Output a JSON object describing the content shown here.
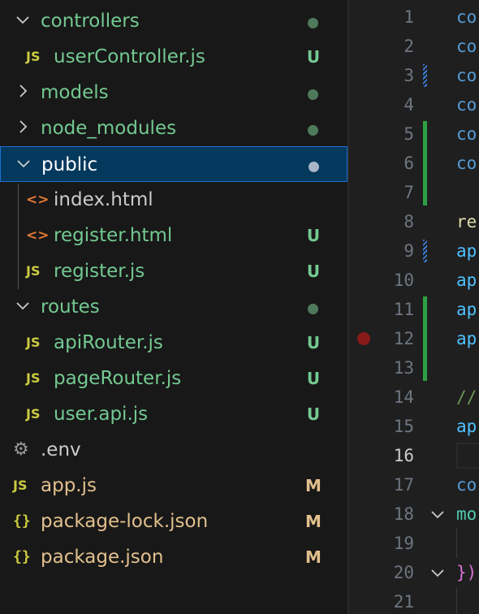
{
  "explorer": {
    "items": [
      {
        "name": "folder-controllers",
        "label": "controllers",
        "kind": "folder",
        "expanded": true,
        "depth": 0,
        "status_dot": "#4e7a5b",
        "label_color": "green"
      },
      {
        "name": "file-userController",
        "label": "userController.js",
        "kind": "js",
        "depth": 1,
        "badge": "U",
        "badge_color": "#73c991",
        "label_color": "green"
      },
      {
        "name": "folder-models",
        "label": "models",
        "kind": "folder",
        "expanded": false,
        "depth": 0,
        "status_dot": "#4e7a5b",
        "label_color": "green"
      },
      {
        "name": "folder-node-modules",
        "label": "node_modules",
        "kind": "folder",
        "expanded": false,
        "depth": 0,
        "status_dot": "#4e7a5b",
        "label_color": "green"
      },
      {
        "name": "folder-public",
        "label": "public",
        "kind": "folder",
        "expanded": true,
        "depth": 0,
        "status_dot": "#a9b4c8",
        "selected": true,
        "label_color": "sel"
      },
      {
        "name": "file-index-html",
        "label": "index.html",
        "kind": "html",
        "depth": 1,
        "label_color": "white"
      },
      {
        "name": "file-register-html",
        "label": "register.html",
        "kind": "html",
        "depth": 1,
        "badge": "U",
        "badge_color": "#73c991",
        "label_color": "green"
      },
      {
        "name": "file-register-js",
        "label": "register.js",
        "kind": "js",
        "depth": 1,
        "badge": "U",
        "badge_color": "#73c991",
        "label_color": "green"
      },
      {
        "name": "folder-routes",
        "label": "routes",
        "kind": "folder",
        "expanded": true,
        "depth": 0,
        "status_dot": "#4e7a5b",
        "label_color": "green"
      },
      {
        "name": "file-apiRouter",
        "label": "apiRouter.js",
        "kind": "js",
        "depth": 1,
        "badge": "U",
        "badge_color": "#73c991",
        "label_color": "green"
      },
      {
        "name": "file-pageRouter",
        "label": "pageRouter.js",
        "kind": "js",
        "depth": 1,
        "badge": "U",
        "badge_color": "#73c991",
        "label_color": "green"
      },
      {
        "name": "file-user-api",
        "label": "user.api.js",
        "kind": "js",
        "depth": 1,
        "badge": "U",
        "badge_color": "#73c991",
        "label_color": "green"
      },
      {
        "name": "file-env",
        "label": ".env",
        "kind": "gear",
        "depth": 0,
        "label_color": "white"
      },
      {
        "name": "file-app-js",
        "label": "app.js",
        "kind": "js",
        "depth": 0,
        "badge": "M",
        "badge_color": "#e2c08d",
        "label_color": "mod"
      },
      {
        "name": "file-package-lock",
        "label": "package-lock.json",
        "kind": "json",
        "depth": 0,
        "badge": "M",
        "badge_color": "#e2c08d",
        "label_color": "mod"
      },
      {
        "name": "file-package",
        "label": "package.json",
        "kind": "json",
        "depth": 0,
        "badge": "M",
        "badge_color": "#e2c08d",
        "label_color": "mod"
      }
    ],
    "icons": {
      "js": "JS",
      "html": "<>",
      "json": "{}",
      "gear": "⚙"
    }
  },
  "editor": {
    "active_line": 16,
    "lines": [
      {
        "n": "1",
        "text": "co",
        "color": "#569cd6"
      },
      {
        "n": "2",
        "text": "co",
        "color": "#569cd6"
      },
      {
        "n": "3",
        "text": "co",
        "color": "#569cd6"
      },
      {
        "n": "4",
        "text": "co",
        "color": "#569cd6"
      },
      {
        "n": "5",
        "text": "co",
        "color": "#569cd6"
      },
      {
        "n": "6",
        "text": "co",
        "color": "#569cd6"
      },
      {
        "n": "7",
        "text": "",
        "color": "#cccccc"
      },
      {
        "n": "8",
        "text": "re",
        "color": "#dcdcaa"
      },
      {
        "n": "9",
        "text": "ap",
        "color": "#4fc1ff"
      },
      {
        "n": "10",
        "text": "ap",
        "color": "#4fc1ff"
      },
      {
        "n": "11",
        "text": "ap",
        "color": "#4fc1ff"
      },
      {
        "n": "12",
        "text": "ap",
        "color": "#4fc1ff"
      },
      {
        "n": "13",
        "text": "",
        "color": "#cccccc"
      },
      {
        "n": "14",
        "text": "//",
        "color": "#6a9955"
      },
      {
        "n": "15",
        "text": "ap",
        "color": "#4fc1ff"
      },
      {
        "n": "16",
        "text": "",
        "color": "#cccccc"
      },
      {
        "n": "17",
        "text": "co",
        "color": "#569cd6"
      },
      {
        "n": "18",
        "text": "mo",
        "color": "#4ec9b0"
      },
      {
        "n": "19",
        "text": "",
        "color": "#cccccc"
      },
      {
        "n": "20",
        "text": "})",
        "color": "#da70d6"
      },
      {
        "n": "21",
        "text": "",
        "color": "#cccccc"
      }
    ],
    "added_ranges": [
      [
        5,
        7
      ],
      [
        11,
        13
      ]
    ],
    "modified_lines": [
      3,
      9
    ],
    "breakpoint_line": 12,
    "fold_lines": [
      18,
      20
    ]
  }
}
